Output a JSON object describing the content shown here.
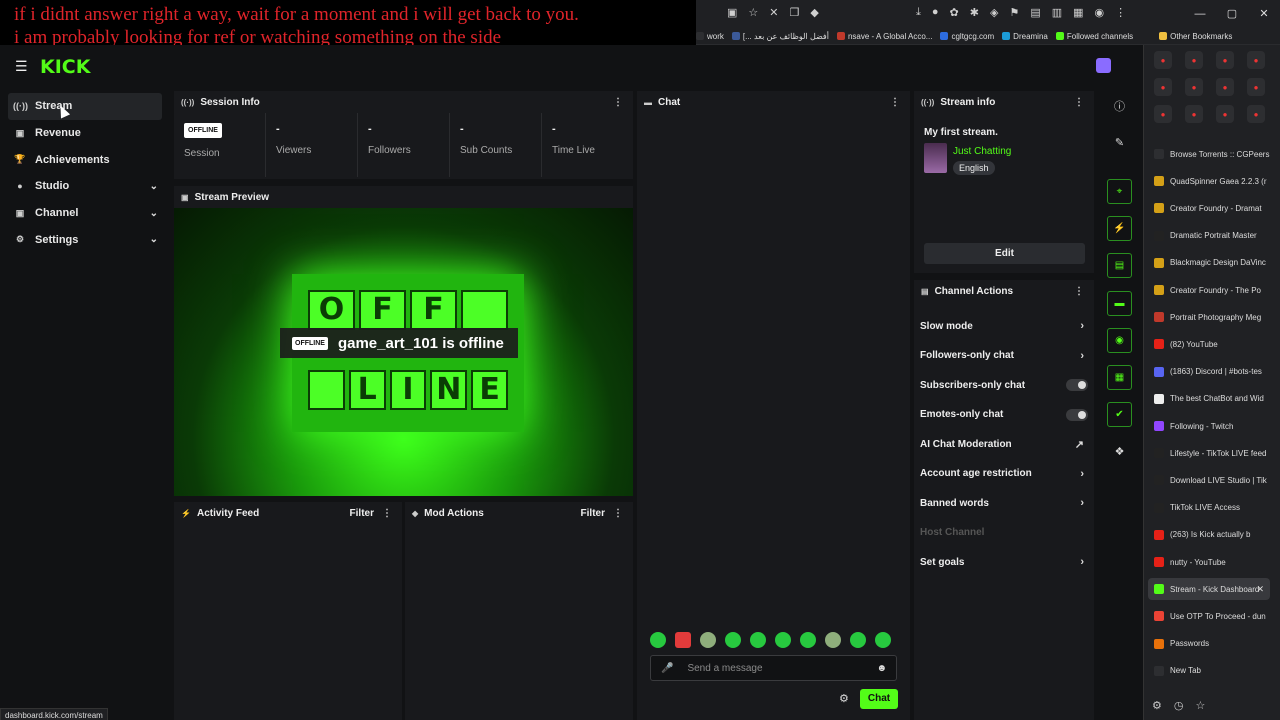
{
  "overlay": {
    "line1": "if i didnt answer right a way, wait for a moment and i will get back to you.",
    "line2": "i am probably looking for ref or watching something on the side"
  },
  "bookmarks": [
    {
      "label": "work",
      "color": "#2d2e31"
    },
    {
      "label": "[... أفضل الوظائف عن بعد",
      "color": "#3b5998"
    },
    {
      "label": "nsave - A Global Acco...",
      "color": "#c0392b"
    },
    {
      "label": "cgltgcg.com",
      "color": "#2d6cdf"
    },
    {
      "label": "Dreamina",
      "color": "#1c9bd6"
    },
    {
      "label": "Followed channels",
      "color": "#53fc18"
    },
    {
      "label": "Other Bookmarks",
      "color": "#f0c040"
    }
  ],
  "header": {
    "logo": "KICK"
  },
  "nav": [
    {
      "label": "Stream",
      "icon": "((·))",
      "active": true,
      "chevron": false
    },
    {
      "label": "Revenue",
      "icon": "▣",
      "active": false,
      "chevron": false
    },
    {
      "label": "Achievements",
      "icon": "🏆",
      "active": false,
      "chevron": false
    },
    {
      "label": "Studio",
      "icon": "●",
      "active": false,
      "chevron": true
    },
    {
      "label": "Channel",
      "icon": "▣",
      "active": false,
      "chevron": true
    },
    {
      "label": "Settings",
      "icon": "⚙",
      "active": false,
      "chevron": true
    }
  ],
  "session": {
    "title": "Session Info",
    "badge": "OFFLINE",
    "stats": [
      {
        "value": "",
        "label": "Session"
      },
      {
        "value": "-",
        "label": "Viewers"
      },
      {
        "value": "-",
        "label": "Followers"
      },
      {
        "value": "-",
        "label": "Sub Counts"
      },
      {
        "value": "-",
        "label": "Time Live"
      }
    ]
  },
  "preview": {
    "title": "Stream Preview",
    "badge": "OFFLINE",
    "message": "game_art_101 is offline",
    "sign_top": [
      "O",
      "F",
      "F",
      ""
    ],
    "sign_bottom": [
      "",
      "L",
      "I",
      "N",
      "E"
    ]
  },
  "activity": {
    "title": "Activity Feed",
    "filter": "Filter"
  },
  "mod": {
    "title": "Mod Actions",
    "filter": "Filter"
  },
  "chat": {
    "title": "Chat",
    "placeholder": "Send a message",
    "send": "Chat"
  },
  "stream_info": {
    "title": "Stream info",
    "stream_title": "My first stream.",
    "category": "Just Chatting",
    "language": "English",
    "edit": "Edit"
  },
  "channel_actions": {
    "title": "Channel Actions",
    "items": [
      {
        "label": "Slow mode",
        "kind": "chevron"
      },
      {
        "label": "Followers-only chat",
        "kind": "chevron"
      },
      {
        "label": "Subscribers-only chat",
        "kind": "toggle"
      },
      {
        "label": "Emotes-only chat",
        "kind": "toggle"
      },
      {
        "label": "AI Chat Moderation",
        "kind": "external"
      },
      {
        "label": "Account age restriction",
        "kind": "chevron"
      },
      {
        "label": "Banned words",
        "kind": "chevron"
      },
      {
        "label": "Host Channel",
        "kind": "disabled"
      },
      {
        "label": "Set goals",
        "kind": "chevron"
      }
    ]
  },
  "side_tabs": [
    {
      "label": "Browse Torrents :: CGPeers",
      "color": "#2d2e31"
    },
    {
      "label": "QuadSpinner Gaea 2.2.3 (r",
      "color": "#d4a017"
    },
    {
      "label": "Creator Foundry - Dramat",
      "color": "#d4a017"
    },
    {
      "label": "Dramatic Portrait Master",
      "color": "#222"
    },
    {
      "label": "Blackmagic Design DaVinc",
      "color": "#d4a017"
    },
    {
      "label": "Creator Foundry - The Po",
      "color": "#d4a017"
    },
    {
      "label": "Portrait Photography Meg",
      "color": "#c0392b"
    },
    {
      "label": "(82) YouTube",
      "color": "#e62117"
    },
    {
      "label": "(1863) Discord | #bots-tes",
      "color": "#5865f2"
    },
    {
      "label": "The best ChatBot and Wid",
      "color": "#eee"
    },
    {
      "label": "Following - Twitch",
      "color": "#9146ff"
    },
    {
      "label": "Lifestyle - TikTok LIVE feed",
      "color": "#222"
    },
    {
      "label": "Download LIVE Studio | Tik",
      "color": "#222"
    },
    {
      "label": "TikTok LIVE Access",
      "color": "#222"
    },
    {
      "label": "(263) Is Kick actually b",
      "color": "#e62117"
    },
    {
      "label": "nutty - YouTube",
      "color": "#e62117"
    },
    {
      "label": "Stream - Kick Dashboard",
      "color": "#53fc18"
    },
    {
      "label": "Use OTP To Proceed - dun",
      "color": "#ea4335"
    },
    {
      "label": "Passwords",
      "color": "#e8710a"
    },
    {
      "label": "New Tab",
      "color": "#2d2e31"
    }
  ],
  "statusbar": "dashboard.kick.com/stream"
}
